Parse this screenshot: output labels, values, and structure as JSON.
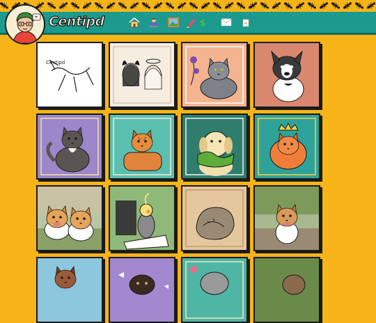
{
  "site": {
    "logo_text": "Centipd"
  },
  "nav": [
    {
      "name": "home",
      "icon": "house-icon",
      "label": "Home"
    },
    {
      "name": "about",
      "icon": "person-at-computer-icon",
      "label": "About"
    },
    {
      "name": "gallery",
      "icon": "framed-picture-icon",
      "label": "Gallery"
    },
    {
      "name": "commissions",
      "icon": "pencil-and-money-icon",
      "label": "Commissions"
    },
    {
      "name": "contact",
      "icon": "envelope-icon",
      "label": "Contact"
    },
    {
      "name": "shop",
      "icon": "shopping-bag-icon",
      "label": "Shop"
    }
  ],
  "colors": {
    "background": "#f7b418",
    "header": "#1c9a8e",
    "border": "#1a1a1a"
  },
  "gallery": [
    {
      "subject": "sketch of a dog stretching, monochrome line art",
      "bg": "#ffffff"
    },
    {
      "subject": "devil and angel characters line art",
      "bg": "#f5ede0"
    },
    {
      "subject": "grey cat with purple flowers",
      "bg": "#f3b48f"
    },
    {
      "subject": "french bulldog",
      "bg": "#d9876e"
    },
    {
      "subject": "dark grey cat with white chest",
      "bg": "#9b87c9"
    },
    {
      "subject": "orange tabby cat",
      "bg": "#5bbfb0"
    },
    {
      "subject": "golden retriever holding green toy",
      "bg": "#2f7d6c"
    },
    {
      "subject": "orange fluffy cat wearing a crown",
      "bg": "#2fa39a"
    },
    {
      "subject": "two corgis in a yard",
      "bg": "#b9c6a5"
    },
    {
      "subject": "cockatiel on a notebook",
      "bg": "#8fb978"
    },
    {
      "subject": "sleeping curled dog",
      "bg": "#e5c79e"
    },
    {
      "subject": "corgi on a wooden deck",
      "bg": "#a8b88f"
    },
    {
      "subject": "brown curly dog",
      "bg": "#8dc7dd"
    },
    {
      "subject": "black and tan dog with bones",
      "bg": "#a289cf"
    },
    {
      "subject": "grey shaggy dog with flowers",
      "bg": "#4fb5a5"
    },
    {
      "subject": "dog in a green garden",
      "bg": "#7c8f5b"
    }
  ]
}
